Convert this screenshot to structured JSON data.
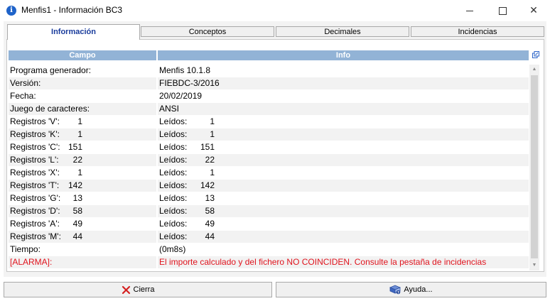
{
  "window": {
    "title": "Menfis1 - Información BC3",
    "icon": "info-icon"
  },
  "tabs": [
    {
      "label": "Información",
      "active": true
    },
    {
      "label": "Conceptos",
      "active": false
    },
    {
      "label": "Decimales",
      "active": false
    },
    {
      "label": "Incidencias",
      "active": false
    }
  ],
  "table": {
    "headers": {
      "campo": "Campo",
      "info": "Info"
    },
    "rows": [
      {
        "campo": "Programa generador:",
        "info": "Menfis 10.1.8"
      },
      {
        "campo": "Versión:",
        "info": "FIEBDC-3/2016"
      },
      {
        "campo": "Fecha:",
        "info": "20/02/2019"
      },
      {
        "campo": "Juego de caracteres:",
        "info": "ANSI"
      }
    ],
    "registros": [
      {
        "label": "Registros 'V':",
        "count": "1",
        "leidos_label": "Leídos:",
        "leidos": "1"
      },
      {
        "label": "Registros 'K':",
        "count": "1",
        "leidos_label": "Leídos:",
        "leidos": "1"
      },
      {
        "label": "Registros 'C':",
        "count": "151",
        "leidos_label": "Leídos:",
        "leidos": "151"
      },
      {
        "label": "Registros 'L':",
        "count": "22",
        "leidos_label": "Leídos:",
        "leidos": "22"
      },
      {
        "label": "Registros 'X':",
        "count": "1",
        "leidos_label": "Leídos:",
        "leidos": "1"
      },
      {
        "label": "Registros 'T':",
        "count": "142",
        "leidos_label": "Leídos:",
        "leidos": "142"
      },
      {
        "label": "Registros 'G':",
        "count": "13",
        "leidos_label": "Leídos:",
        "leidos": "13"
      },
      {
        "label": "Registros 'D':",
        "count": "58",
        "leidos_label": "Leídos:",
        "leidos": "58"
      },
      {
        "label": "Registros 'A':",
        "count": "49",
        "leidos_label": "Leídos:",
        "leidos": "49"
      },
      {
        "label": "Registros 'M':",
        "count": "44",
        "leidos_label": "Leídos:",
        "leidos": "44"
      }
    ],
    "tiempo": {
      "campo": "Tiempo:",
      "info": "(0m8s)"
    },
    "alarma": {
      "campo": "[ALARMA]:",
      "info": "El importe calculado y del fichero NO COINCIDEN. Consulte la pestaña de incidencias"
    }
  },
  "buttons": {
    "close_label": "Cierra",
    "help_label": "Ayuda..."
  },
  "colors": {
    "header_bg": "#92b3d6",
    "active_tab_text": "#1a3c9c",
    "alarm_text": "#e0141e",
    "close_icon": "#d42020"
  }
}
